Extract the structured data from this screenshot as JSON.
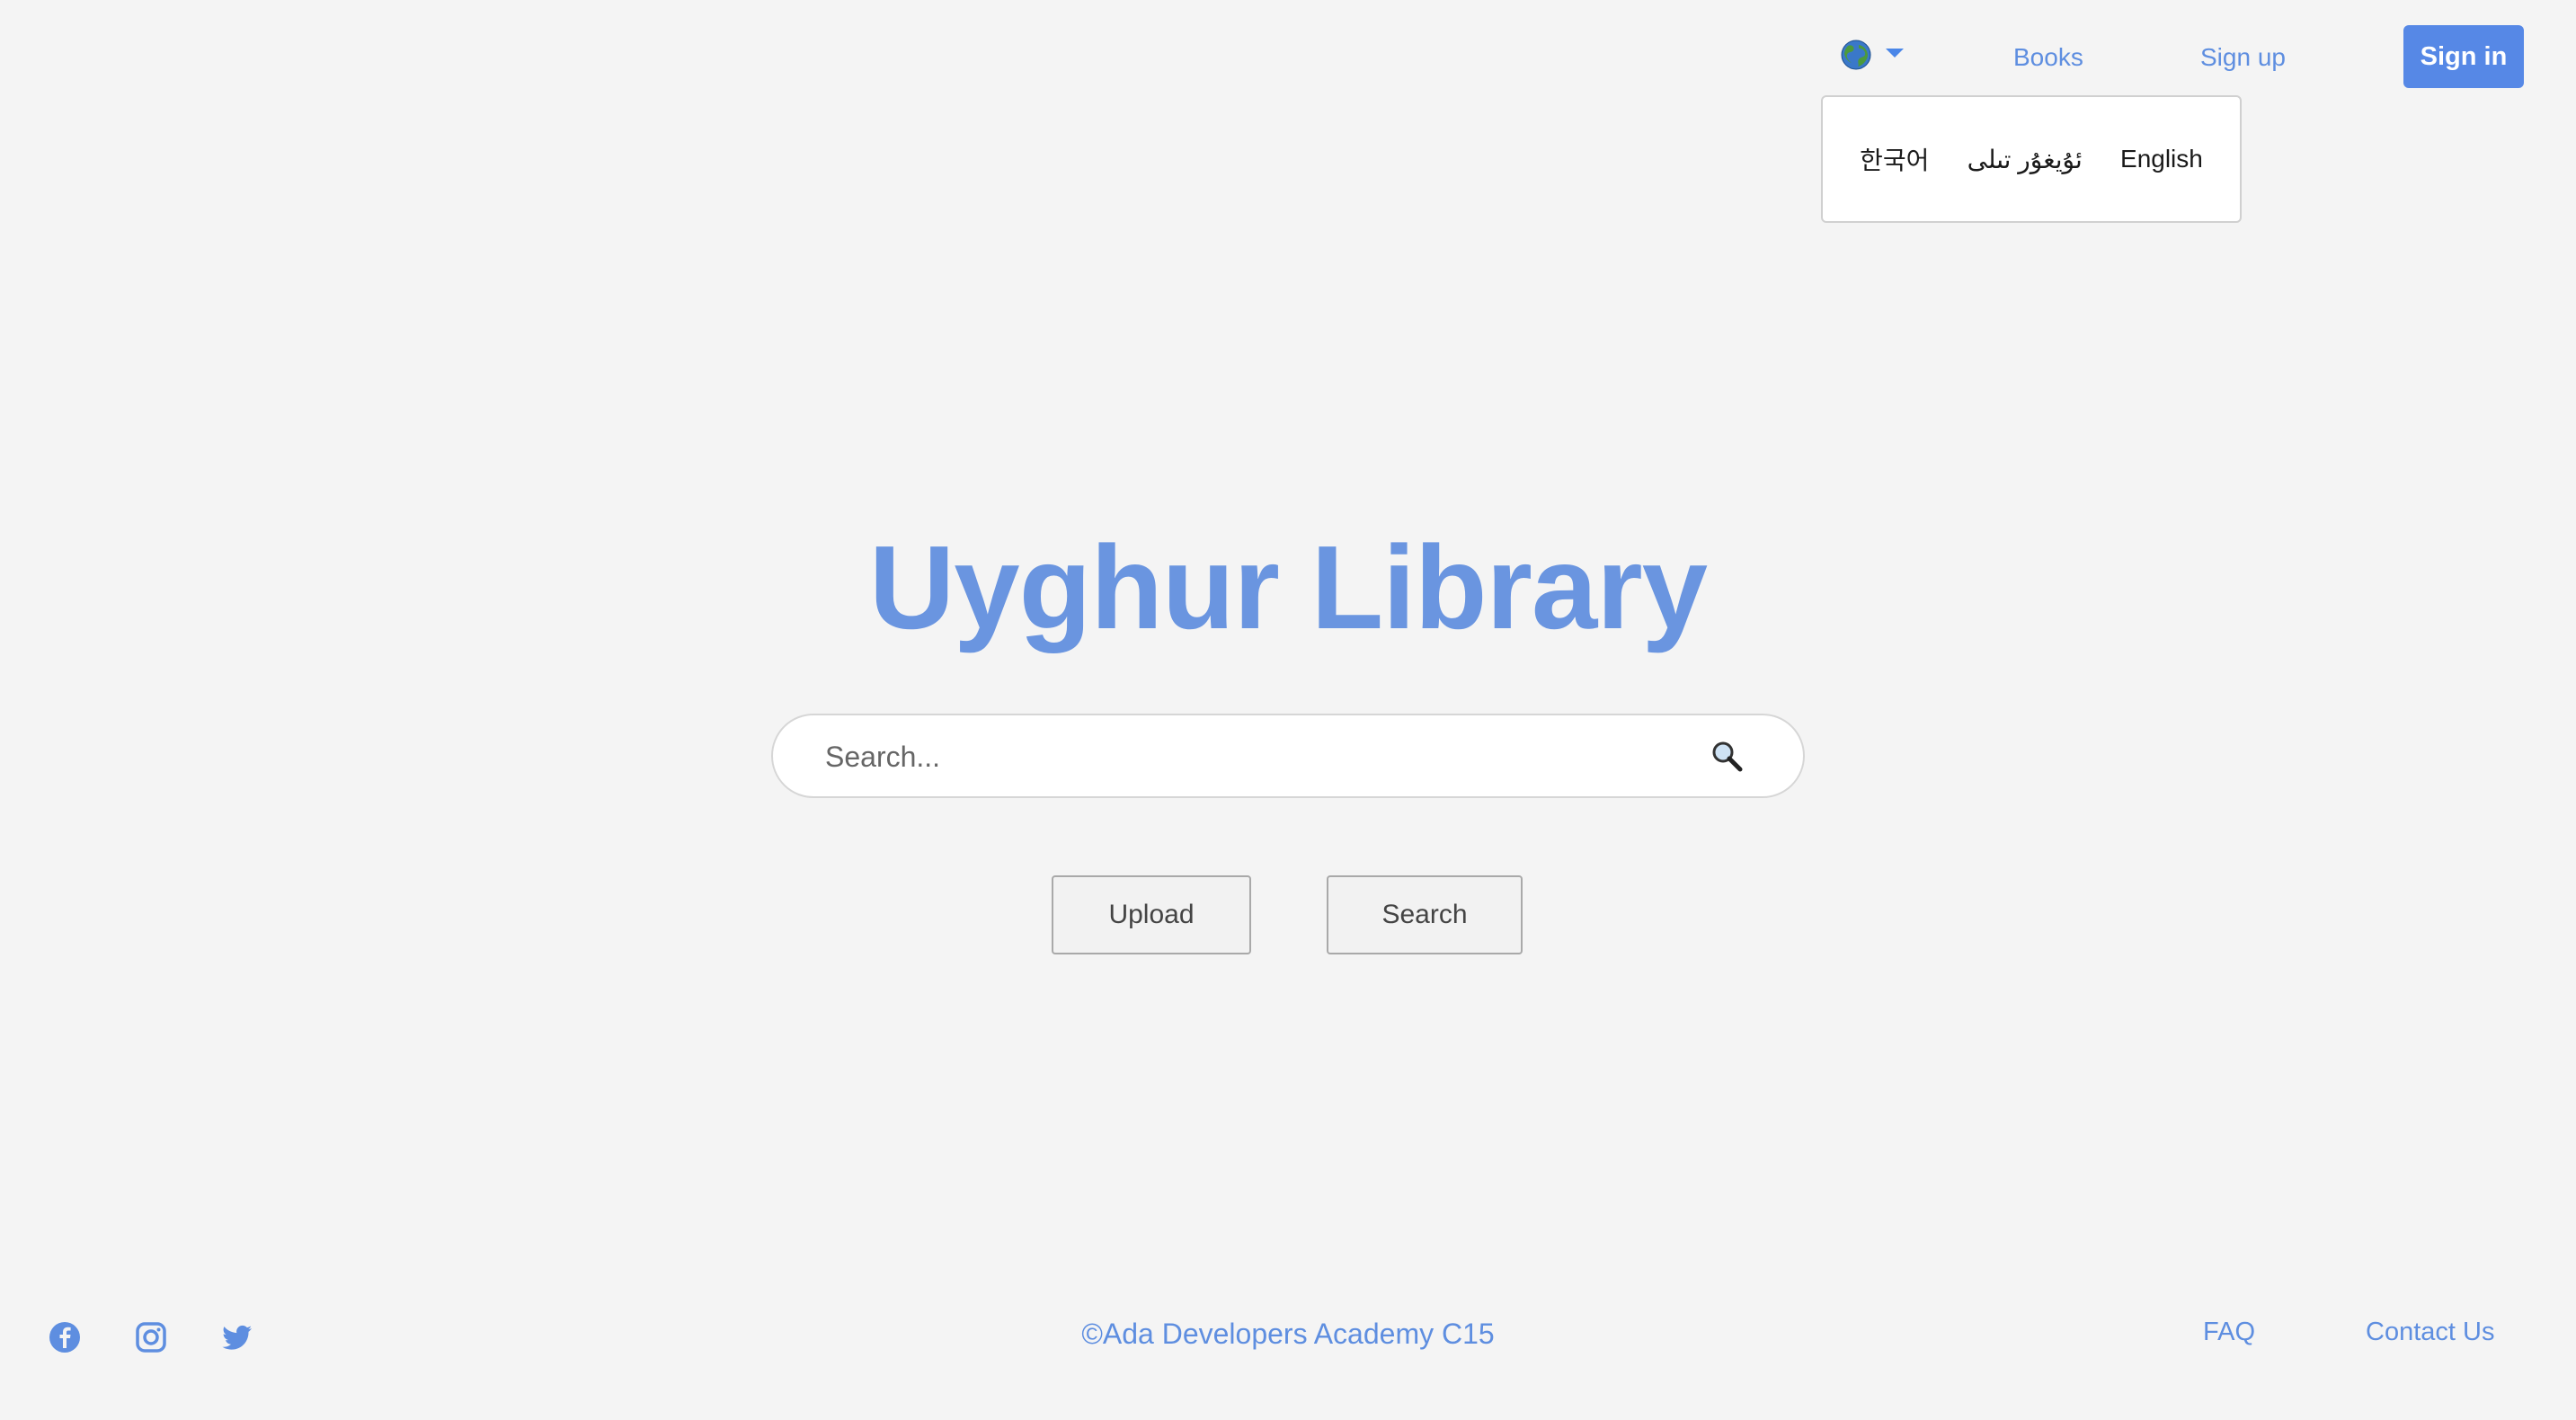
{
  "header": {
    "language_icon": "globe-icon",
    "books_label": "Books",
    "signup_label": "Sign up",
    "signin_label": "Sign in"
  },
  "language_menu": {
    "items": [
      "한국어",
      "ئۇيغۇر تىلى",
      "English"
    ]
  },
  "main": {
    "title": "Uyghur Library",
    "search_placeholder": "Search...",
    "search_icon": "magnifier-icon",
    "upload_label": "Upload",
    "search_button_label": "Search"
  },
  "footer": {
    "social_icons": [
      "facebook-icon",
      "instagram-icon",
      "twitter-icon"
    ],
    "copyright": "©Ada Developers Academy C15",
    "faq_label": "FAQ",
    "contact_label": "Contact Us"
  },
  "colors": {
    "accent": "#5688e6",
    "link": "#5e8ee0",
    "background": "#f4f4f4"
  }
}
